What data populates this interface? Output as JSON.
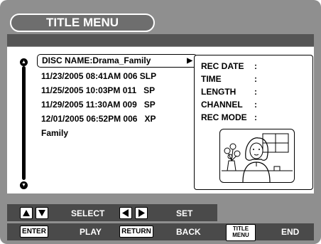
{
  "title": "TITLE MENU",
  "disc_name": "DISC NAME:Drama_Family",
  "titles": [
    "11/23/2005 08:41AM 006 SLP",
    "11/25/2005 10:03PM 011   SP",
    "11/29/2005 11:30AM 009   SP",
    "12/01/2005 06:52PM 006   XP",
    "Family"
  ],
  "info_labels": [
    "REC DATE",
    "TIME",
    "LENGTH",
    "CHANNEL",
    "REC MODE"
  ],
  "info_colon": ":",
  "controls": {
    "select": "SELECT",
    "set": "SET",
    "enter_key": "ENTER",
    "play": "PLAY",
    "return_key": "RETURN",
    "back": "BACK",
    "title_menu_key_line1": "TITLE",
    "title_menu_key_line2": "MENU",
    "end": "END"
  },
  "icons": {
    "up": "triangle-up-icon",
    "down": "triangle-down-icon",
    "left": "triangle-left-icon",
    "right": "triangle-right-icon",
    "play": "play-arrow-icon"
  }
}
